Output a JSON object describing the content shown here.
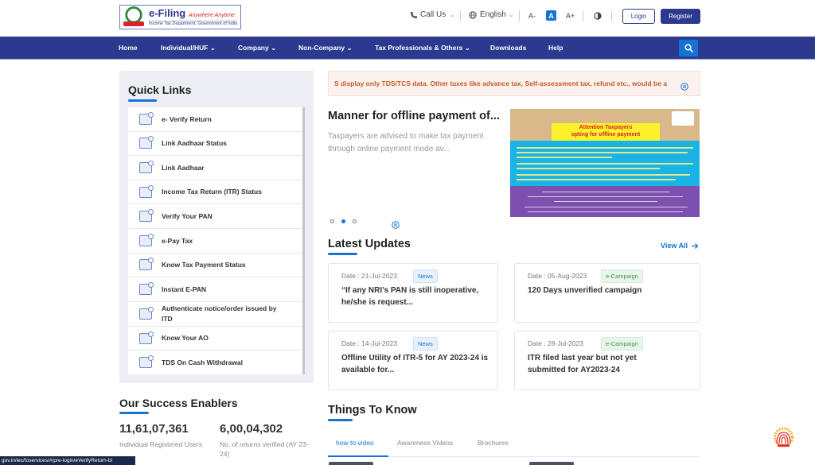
{
  "header": {
    "logo": {
      "title": "e-Filing",
      "tagline": "Anywhere Anytime",
      "subtitle": "Income Tax Department, Government of India"
    },
    "utilities": {
      "call_us": "Call Us",
      "language": "English",
      "font_decrease": "A-",
      "font_normal": "A",
      "font_increase": "A+"
    },
    "login_label": "Login",
    "register_label": "Register"
  },
  "nav": {
    "items": [
      {
        "label": "Home",
        "has_dropdown": false
      },
      {
        "label": "Individual/HUF",
        "has_dropdown": true
      },
      {
        "label": "Company",
        "has_dropdown": true
      },
      {
        "label": "Non-Company",
        "has_dropdown": true
      },
      {
        "label": "Tax Professionals & Others",
        "has_dropdown": true
      },
      {
        "label": "Downloads",
        "has_dropdown": false
      },
      {
        "label": "Help",
        "has_dropdown": false
      }
    ],
    "search_icon": "search-icon"
  },
  "quick_links": {
    "title": "Quick Links",
    "items": [
      {
        "label": "e- Verify Return",
        "icon": "envelope-verify-icon"
      },
      {
        "label": "Link Aadhaar Status",
        "icon": "id-card-icon"
      },
      {
        "label": "Link Aadhaar",
        "icon": "id-card-link-icon"
      },
      {
        "label": "Income Tax Return (ITR) Status",
        "icon": "document-status-icon"
      },
      {
        "label": "Verify Your PAN",
        "icon": "pan-card-icon"
      },
      {
        "label": "e-Pay Tax",
        "icon": "wallet-icon"
      },
      {
        "label": "Know Tax Payment Status",
        "icon": "receipt-icon"
      },
      {
        "label": "Instant E-PAN",
        "icon": "pan-card-icon"
      },
      {
        "label": "Authenticate notice/order issued by ITD",
        "icon": "envelope-verify-icon"
      },
      {
        "label": "Know Your AO",
        "icon": "document-user-icon"
      },
      {
        "label": "TDS On Cash Withdrawal",
        "icon": "atm-icon"
      }
    ]
  },
  "success_enablers": {
    "title": "Our Success Enablers",
    "stats": [
      {
        "value": "11,61,07,361",
        "label": "Individual Registered Users"
      },
      {
        "value": "6,00,04,302",
        "label": "No. of returns verified (AY 23-24)"
      }
    ]
  },
  "ticker": {
    "text": "S display only TDS/TCS data. Other taxes like advance tax, Self-assessment tax, refund etc., would be a",
    "color": "#c85a2a"
  },
  "hero": {
    "title": "Manner for offline payment of...",
    "text": "Taxpayers are advised to make tax payment through online payment mode av...",
    "slides": 3,
    "active_slide": 2,
    "banner": {
      "heading_line1": "Attention Taxpayers",
      "heading_line2": "opting for offline payment"
    }
  },
  "latest_updates": {
    "title": "Latest Updates",
    "view_all": "View All",
    "cards": [
      {
        "date": "Date : 21-Jul-2023",
        "badge": "News",
        "badge_type": "news",
        "title": "“If any NRI’s PAN is still inoperative, he/she is request..."
      },
      {
        "date": "Date : 05-Aug-2023",
        "badge": "e-Campaign",
        "badge_type": "camp",
        "title": "120 Days unverified campaign"
      },
      {
        "date": "Date : 14-Jul-2023",
        "badge": "News",
        "badge_type": "news",
        "title": "Offline Utility of ITR-5 for AY 2023-24 is available for..."
      },
      {
        "date": "Date : 28-Jul-2023",
        "badge": "e-Campaign",
        "badge_type": "camp",
        "title": "ITR filed last year but not yet submitted for AY2023-24"
      }
    ]
  },
  "things_to_know": {
    "title": "Things To Know",
    "tabs": [
      {
        "label": "how to video",
        "active": true
      },
      {
        "label": "Awareness Videos",
        "active": false
      },
      {
        "label": "Brochures",
        "active": false
      }
    ]
  },
  "status_bar": {
    "url": "gov.in/iec/foservices/#/pre-login/eVerifyReturn-bl"
  },
  "colors": {
    "brand_navy": "#2b3a8e",
    "accent_blue": "#1673d5",
    "news_badge": "#1673d5",
    "campaign_badge": "#3e9a4a"
  }
}
